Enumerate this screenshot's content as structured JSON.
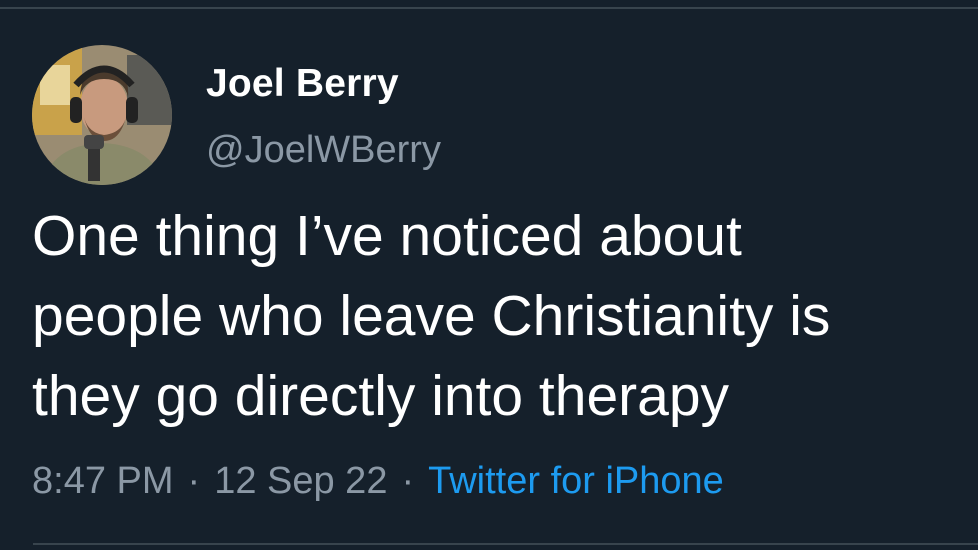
{
  "tweet": {
    "author": {
      "display_name": "Joel Berry",
      "handle": "@JoelWBerry",
      "avatar_icon": "profile-photo"
    },
    "text_lines": [
      "One thing I’ve noticed about",
      "people who leave Christianity is",
      "they go directly into therapy"
    ],
    "time": "8:47 PM",
    "separator": "·",
    "date": "12 Sep 22",
    "source": "Twitter for iPhone"
  },
  "colors": {
    "background": "#15202b",
    "primary_text": "#ffffff",
    "secondary_text": "#8b98a5",
    "link": "#1d9bf0",
    "divider": "#38444d"
  }
}
